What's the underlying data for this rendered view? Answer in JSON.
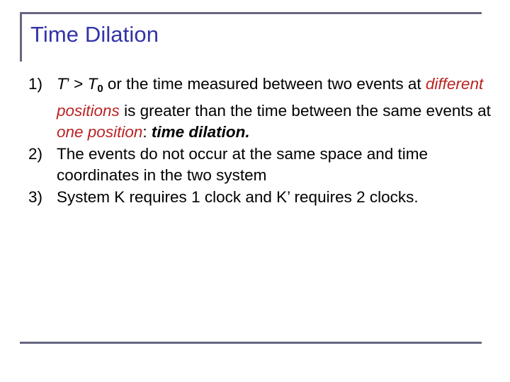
{
  "slide": {
    "title": "Time Dilation",
    "accent_color": "#666680",
    "title_color": "#3333a8",
    "emphasis_color": "#bb2222",
    "background_color": "#ffffff"
  },
  "body": {
    "items": [
      {
        "marker": "1)",
        "segments": [
          {
            "style": "italic",
            "text": "T"
          },
          {
            "style": "plain",
            "text": "’ > "
          },
          {
            "style": "italic",
            "text": "T"
          },
          {
            "style": "subscript",
            "text": "0"
          },
          {
            "style": "plain",
            "text": " or the time measured between two events at "
          },
          {
            "style": "red-italic",
            "text": "different positions"
          },
          {
            "style": "plain",
            "text": " is greater than the time between the same events at "
          },
          {
            "style": "red-italic",
            "text": "one position"
          },
          {
            "style": "plain",
            "text": ": "
          },
          {
            "style": "bold-italic",
            "text": "time dilation."
          }
        ]
      },
      {
        "marker": "2)",
        "segments": [
          {
            "style": "plain",
            "text": "The events do not occur at the same space and time coordinates in the two system"
          }
        ]
      },
      {
        "marker": "3)",
        "segments": [
          {
            "style": "plain",
            "text": "System K requires 1 clock and K’ requires 2 clocks."
          }
        ]
      }
    ]
  }
}
